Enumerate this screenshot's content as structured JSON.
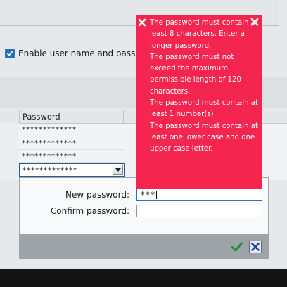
{
  "settings": {
    "enable_username_label": "Enable user name and passwo",
    "enable_username_checked": true
  },
  "grid": {
    "column_header": "Password",
    "rows": [
      "*************",
      "*************",
      "*************",
      "*************"
    ],
    "selected_row_index": 3
  },
  "password_dialog": {
    "new_password_label": "New password:",
    "new_password_value": "***",
    "confirm_password_label": "Confirm password:",
    "confirm_password_value": "",
    "ok_icon": "green-check-icon",
    "cancel_icon": "blue-x-icon"
  },
  "error_tooltip": {
    "messages": [
      "The password must contain at least 8 characters. Enter a longer password.",
      "The password must not exceed the maximum permissible length of 120 characters.",
      "The password must contain at least 1 number(s)",
      "The password must contain at least one lower case and one upper case letter."
    ],
    "background_color": "#f4254e",
    "error_icon": "white-x-icon",
    "close_icon": "close-icon"
  }
}
